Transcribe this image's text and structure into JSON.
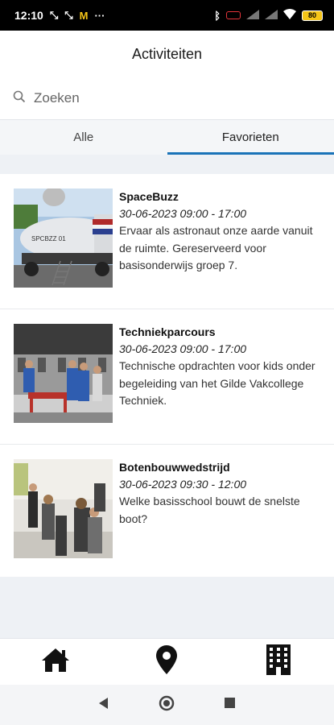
{
  "status": {
    "time": "12:10",
    "battery": "80"
  },
  "header": {
    "title": "Activiteiten"
  },
  "search": {
    "placeholder": "Zoeken"
  },
  "tabs": [
    {
      "label": "Alle",
      "active": false
    },
    {
      "label": "Favorieten",
      "active": true
    }
  ],
  "activities": [
    {
      "title": "SpaceBuzz",
      "date": "30-06-2023 09:00 - 17:00",
      "description": "Ervaar als astronaut onze aarde vanuit de ruimte. Gereserveerd voor basisonderwijs groep 7.",
      "image_text": "SPCBZZ 01"
    },
    {
      "title": "Techniekparcours",
      "date": "30-06-2023 09:00 - 17:00",
      "description": "Technische opdrachten voor kids onder begeleiding van het Gilde Vakcollege Techniek."
    },
    {
      "title": "Botenbouwwedstrijd",
      "date": "30-06-2023 09:30 - 12:00",
      "description": "Welke basisschool bouwt de snelste boot?"
    }
  ],
  "bottom_nav": [
    "home-icon",
    "location-pin-icon",
    "building-icon"
  ],
  "colors": {
    "accent": "#1a73b8",
    "background": "#eef1f5"
  }
}
